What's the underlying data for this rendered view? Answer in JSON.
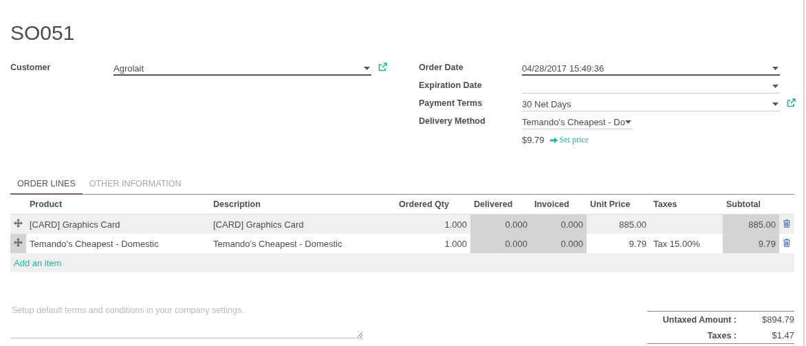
{
  "title": "SO051",
  "left_fields": [
    {
      "label": "Customer",
      "value": "Agrolait",
      "required": true,
      "external_link": true,
      "compact": false
    }
  ],
  "right_fields": [
    {
      "label": "Order Date",
      "value": "04/28/2017 15:49:36",
      "required": true,
      "external_link": false,
      "compact": false
    },
    {
      "label": "Expiration Date",
      "required": false,
      "external_link": false,
      "compact": false
    },
    {
      "label": "Payment Terms",
      "value": "30 Net Days",
      "required": false,
      "external_link": true,
      "compact": false
    },
    {
      "label": "Delivery Method",
      "value": "Temando's Cheapest - Do",
      "required": false,
      "external_link": false,
      "compact": true
    }
  ],
  "delivery_price": {
    "amount": "$9.79",
    "action": "Set price"
  },
  "tabs": [
    {
      "label": "ORDER LINES",
      "selected": true
    },
    {
      "label": "OTHER INFORMATION",
      "selected": false
    }
  ],
  "table": {
    "columns": [
      {
        "label": "Product",
        "kind": "text",
        "readonly": false
      },
      {
        "label": "Description",
        "kind": "text",
        "readonly": false
      },
      {
        "label": "Ordered Qty",
        "kind": "number",
        "readonly": false
      },
      {
        "label": "Delivered",
        "kind": "number",
        "readonly": true
      },
      {
        "label": "Invoiced",
        "kind": "number",
        "readonly": true
      },
      {
        "label": "Unit Price",
        "kind": "number",
        "readonly": false
      },
      {
        "label": "Taxes",
        "kind": "text",
        "readonly": false
      },
      {
        "label": "Subtotal",
        "kind": "number",
        "readonly": true
      }
    ],
    "rows": [
      {
        "highlighted": true,
        "cells": [
          "[CARD] Graphics Card",
          "[CARD] Graphics Card",
          "1.000",
          "0.000",
          "0.000",
          "885.00",
          "",
          "885.00"
        ]
      },
      {
        "highlighted": false,
        "cells": [
          "Temando's Cheapest - Domestic",
          "Temando's Cheapest - Domestic",
          "1.000",
          "0.000",
          "0.000",
          "9.79",
          "Tax 15.00%",
          "9.79"
        ]
      }
    ],
    "add_item": "Add an item"
  },
  "notes": {
    "placeholder": "Setup default terms and conditions in your company settings."
  },
  "totals": [
    {
      "label": "Untaxed Amount :",
      "value": "$894.79"
    },
    {
      "label": "Taxes :",
      "value": "$1.47"
    }
  ]
}
